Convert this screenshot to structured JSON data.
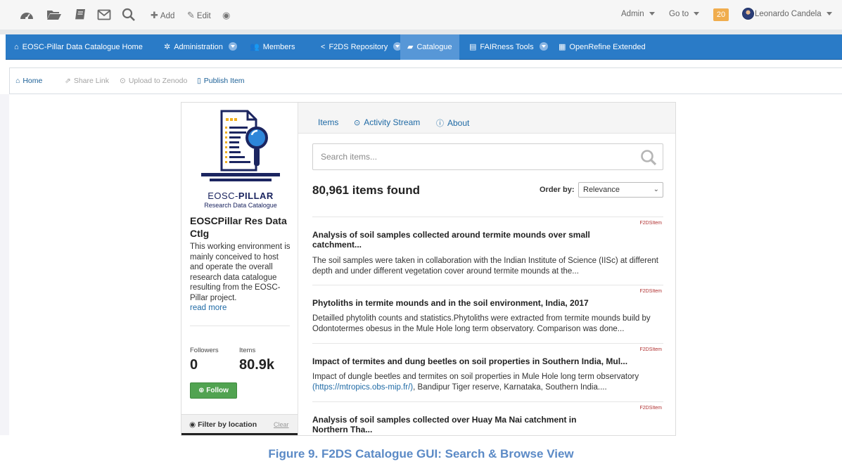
{
  "toolbar": {
    "icons": [
      "dashboard-icon",
      "folder-icon",
      "book-icon",
      "mail-icon",
      "search-icon"
    ],
    "add_label": "Add",
    "edit_label": "Edit",
    "admin_label": "Admin",
    "goto_label": "Go to",
    "notification_count": "20",
    "user_name": "Leonardo Candela"
  },
  "nav": {
    "items": [
      {
        "label": "EOSC-Pillar Data Catalogue Home",
        "icon": "home-icon"
      },
      {
        "label": "Administration",
        "icon": "gear-icon"
      },
      {
        "label": "Members",
        "icon": "users-icon"
      },
      {
        "label": "F2DS Repository",
        "icon": "share-icon"
      },
      {
        "label": "Catalogue",
        "icon": "book-icon",
        "active": true
      },
      {
        "label": "FAIRness Tools",
        "icon": "clipboard-icon"
      },
      {
        "label": "OpenRefine Extended",
        "icon": "table-icon"
      }
    ]
  },
  "subnav": {
    "home": "Home",
    "share": "Share Link",
    "upload": "Upload to Zenodo",
    "publish": "Publish Item"
  },
  "sidebar": {
    "logo_title_light": "EOSC-",
    "logo_title_bold": "PILLAR",
    "logo_subtitle": "Research Data Catalogue",
    "org_name": "EOSCPillar Res Data Ctlg",
    "description": "This working environment is mainly conceived to host and operate the overall research data catalogue resulting from the EOSC-Pillar project.",
    "read_more": "read more",
    "followers_label": "Followers",
    "followers_value": "0",
    "items_label": "Items",
    "items_value": "80.9k",
    "follow_label": "Follow",
    "filter_title": "Filter by location",
    "filter_clear": "Clear",
    "accent_color": "#1b2560"
  },
  "main": {
    "tabs": [
      {
        "label": "Items"
      },
      {
        "label": "Activity Stream",
        "icon": "clock-icon"
      },
      {
        "label": "About",
        "icon": "info-icon"
      }
    ],
    "search_placeholder": "Search items...",
    "found": "80,961 items found",
    "order_by_label": "Order by:",
    "order_by_value": "Relevance",
    "results": [
      {
        "badge": "F2DSItem",
        "title": "Analysis of soil samples collected around termite mounds over small catchment...",
        "description": "The soil samples were taken in collaboration with the Indian Institute of Science (IISc) at different depth and under different vegetation cover around termite mounds at the..."
      },
      {
        "badge": "F2DSItem",
        "title": "Phytoliths in termite mounds and in the soil environment, India, 2017",
        "description": "Detailled phytolith counts and statistics.Phytoliths were extracted from termite mounds build by Odontotermes obesus in the Mule Hole long term observatory. Comparison was done..."
      },
      {
        "badge": "F2DSItem",
        "title": "Impact of termites and dung beetles on soil properties in Southern India, Mul...",
        "description_prefix": "Impact of dungle beetles and termites on soil properties in Mule Hole long term observatory",
        "description_link": "(https://mtropics.obs-mip.fr/)",
        "description_suffix": ", Bandipur Tiger reserve, Karnataka, Southern India...."
      },
      {
        "badge": "F2DSItem",
        "title": "Analysis of soil samples collected over Huay Ma Nai catchment in Northern Tha..."
      }
    ]
  },
  "caption": "Figure 9. F2DS Catalogue GUI: Search & Browse View",
  "colors": {
    "nav_blue": "#2a7bc7",
    "nav_active": "#5797d7",
    "follow_green": "#51a351",
    "notification_orange": "#f0ad4e",
    "caption_blue": "#5b8ac6"
  }
}
